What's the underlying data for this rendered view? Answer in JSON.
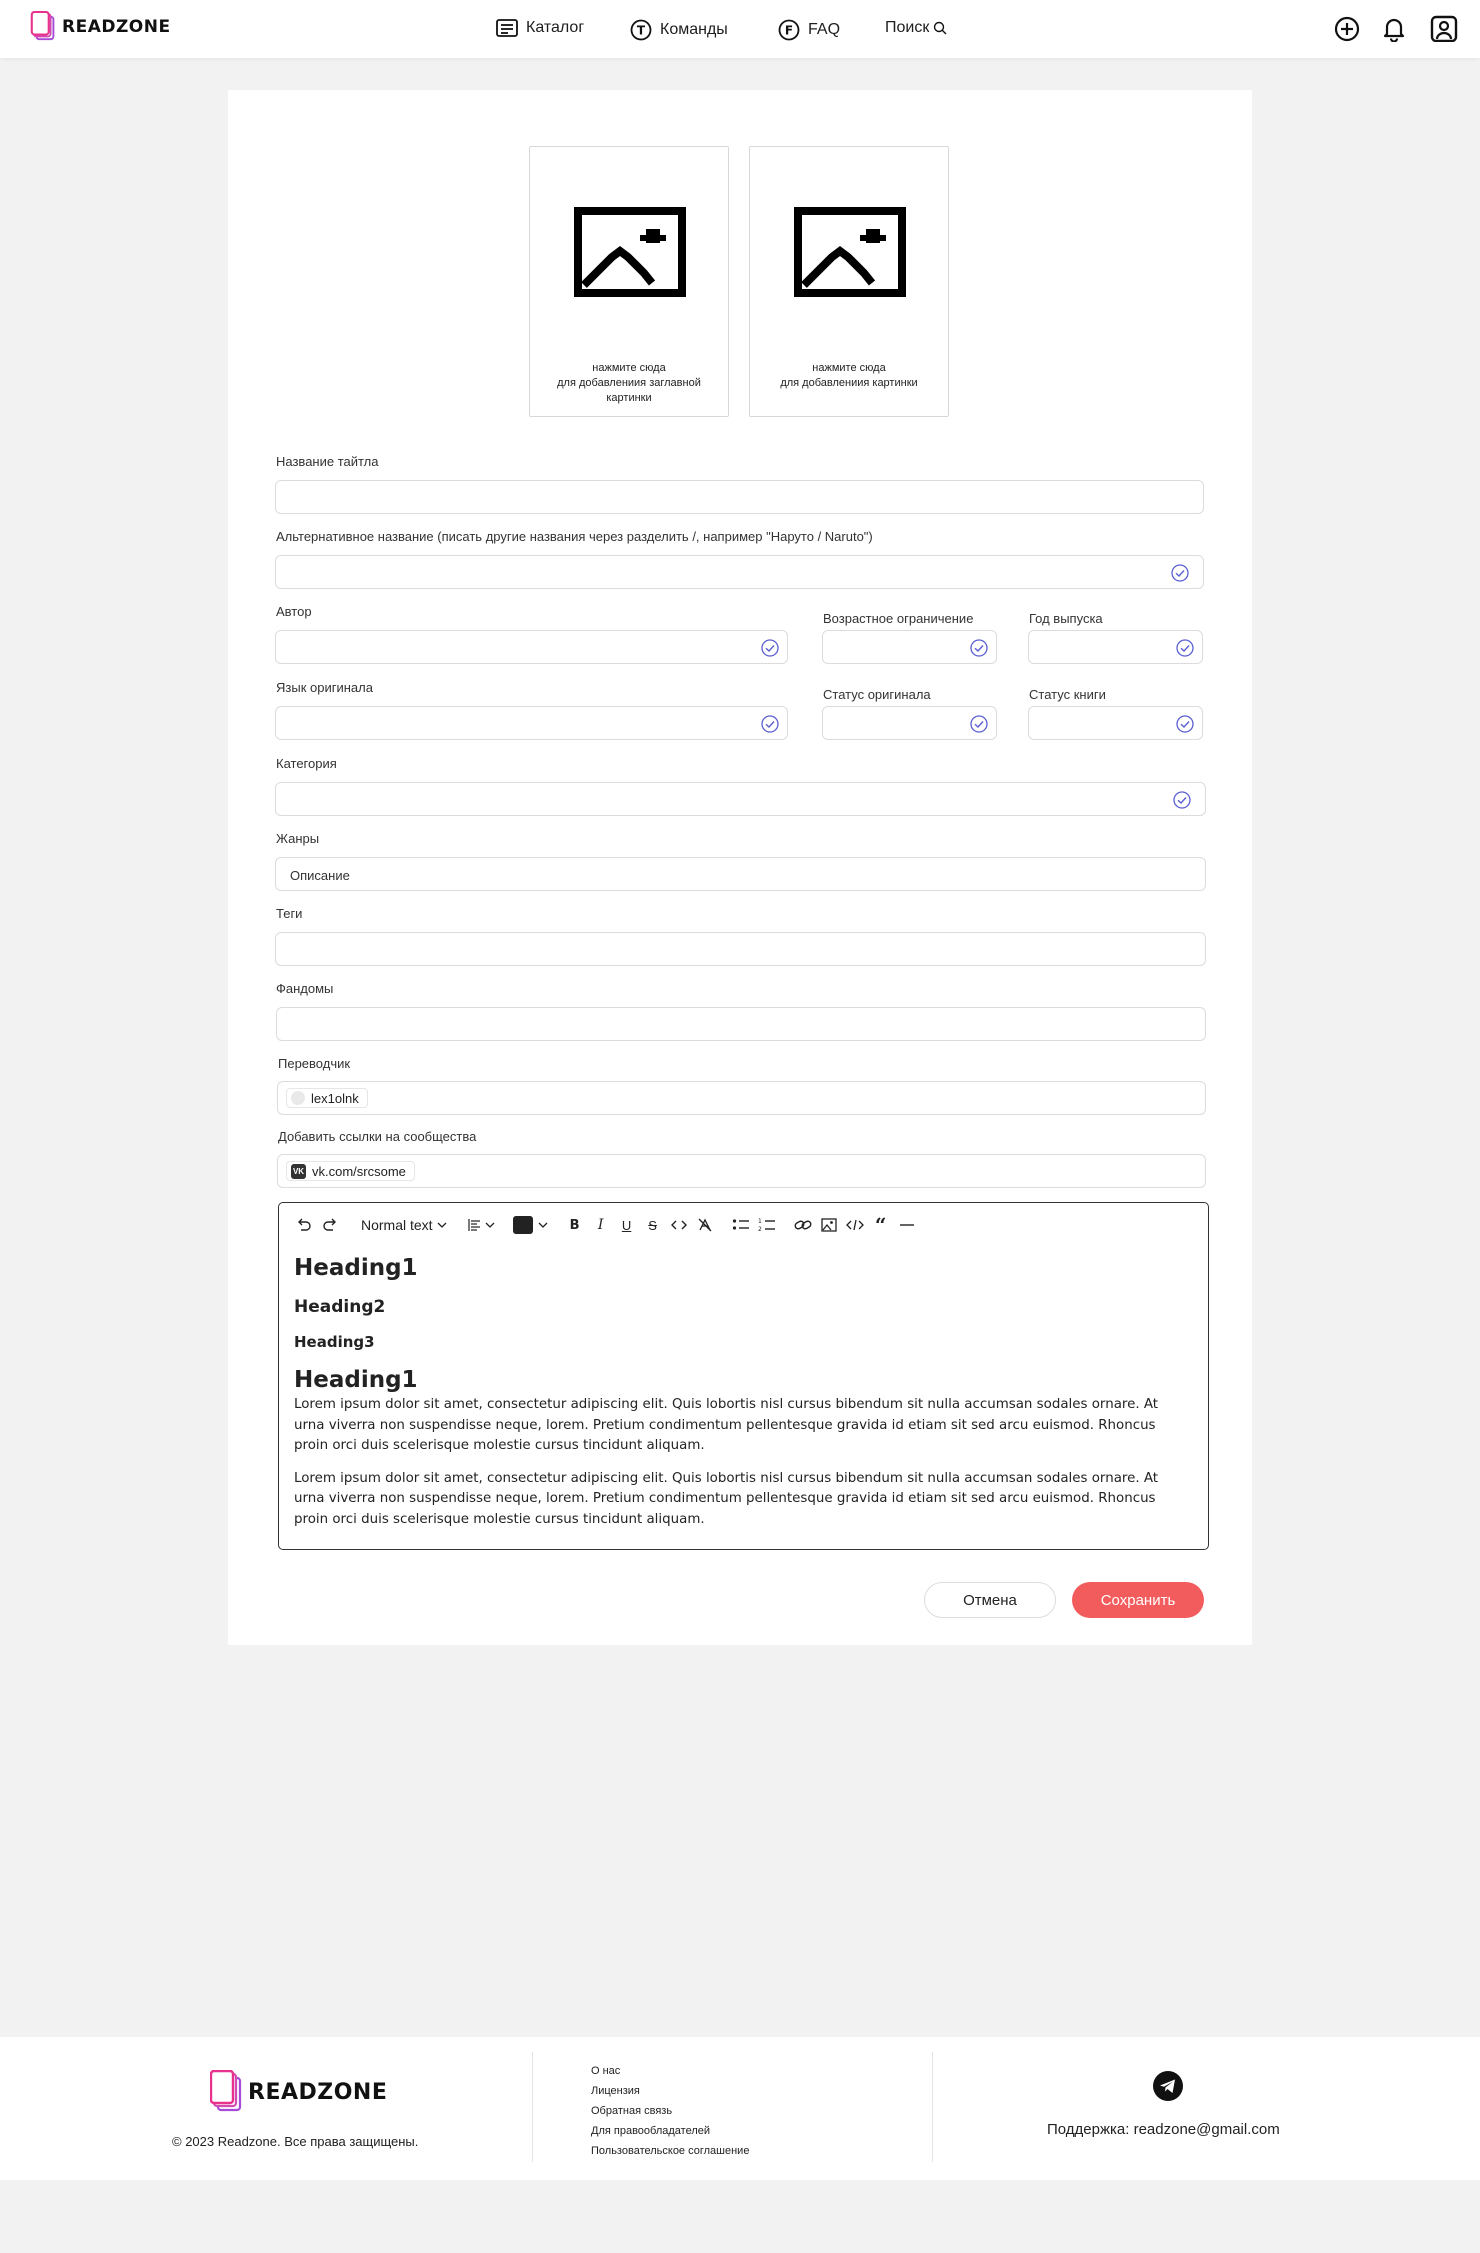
{
  "header": {
    "logo_text": "READZONE",
    "nav": [
      {
        "label": "Каталог",
        "icon": "catalog-icon"
      },
      {
        "label": "Команды",
        "icon": "teams-icon"
      },
      {
        "label": "FAQ",
        "icon": "faq-icon"
      }
    ],
    "search_label": "Поиск",
    "icons": [
      "add-icon",
      "bell-icon",
      "profile-icon"
    ]
  },
  "uploads": [
    {
      "caption": "нажмите сюда\nдля добавлениия заглавной\nкартинки"
    },
    {
      "caption": "нажмите сюда\nдля добавлениия картинки"
    }
  ],
  "form": {
    "title_label": "Название тайтла",
    "title_value": "",
    "alt_label": "Альтернативное название (писать другие названия через разделить /, например \"Наруто / Naruto\")",
    "author_label": "Автор",
    "age_label": "Возрастное ограничение",
    "year_label": "Год выпуска",
    "lang_label": "Язык оригинала",
    "orig_status_label": "Статус оригинала",
    "book_status_label": "Статус книги",
    "category_label": "Категория",
    "genres_label": "Жанры",
    "genres_value": "Описание",
    "tags_label": "Теги",
    "fandoms_label": "Фандомы",
    "translator_label": "Переводчик",
    "translator_chip": "lex1olnk",
    "links_label": "Добавить ссылки на сообщества",
    "link_chip": "vk.com/srcsome",
    "link_chip_icon": "VK"
  },
  "editor": {
    "block_type": "Normal text",
    "text_color": "#222222",
    "h1": "Heading1",
    "h2": "Heading2",
    "h3": "Heading3",
    "h1b": "Heading1",
    "p1": "Lorem ipsum dolor sit amet, consectetur adipiscing elit. Quis lobortis nisl cursus bibendum sit nulla accumsan sodales ornare. At urna viverra non suspendisse neque, lorem. Pretium condimentum pellentesque gravida id etiam sit sed arcu euismod. Rhoncus proin orci duis scelerisque molestie cursus tincidunt aliquam.",
    "p2": "Lorem ipsum dolor sit amet, consectetur adipiscing elit. Quis lobortis nisl cursus bibendum sit nulla accumsan sodales ornare. At urna viverra non suspendisse neque, lorem. Pretium condimentum pellentesque gravida id etiam sit sed arcu euismod. Rhoncus proin orci duis scelerisque molestie cursus tincidunt aliquam."
  },
  "actions": {
    "cancel": "Отмена",
    "save": "Сохранить"
  },
  "footer": {
    "logo_text": "READZONE",
    "copyright": "© 2023 Readzone. Все права защищены.",
    "links": [
      "О нас",
      "Лицензия",
      "Обратная связь",
      "Для правообладателей",
      "Пользовательское соглашение"
    ],
    "support": "Поддержка: readzone@gmail.com"
  },
  "colors": {
    "accent": "#f25c5c",
    "check": "#5a5fd1",
    "logo_pink": "#e8308c",
    "logo_violet": "#a64bd8"
  }
}
